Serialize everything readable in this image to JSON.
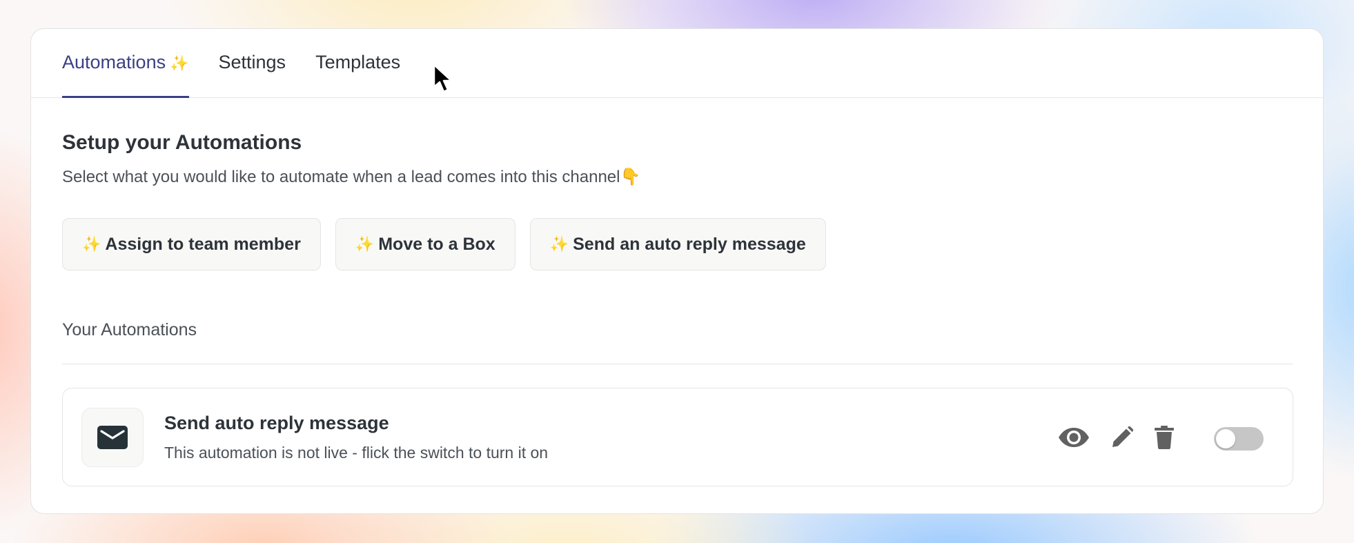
{
  "tabs": [
    {
      "label": "Automations",
      "spark": "✨",
      "active": true
    },
    {
      "label": "Settings",
      "active": false
    },
    {
      "label": "Templates",
      "active": false
    }
  ],
  "header": {
    "title": "Setup your Automations",
    "subtitle": "Select what you would like to automate when a lead comes into this channel👇"
  },
  "actions": [
    {
      "spark": "✨",
      "label": "Assign to team member"
    },
    {
      "spark": "✨",
      "label": "Move to a Box"
    },
    {
      "spark": "✨",
      "label": "Send an auto reply message"
    }
  ],
  "automations_section": {
    "label": "Your Automations",
    "items": [
      {
        "icon": "envelope-icon",
        "name": "Send auto reply message",
        "description": "This automation is not live - flick the switch to turn it on",
        "enabled": false
      }
    ]
  },
  "colors": {
    "accent": "#3b3f86",
    "text": "#2d3339",
    "muted": "#4a5057",
    "toggle_off": "#c6c6c6"
  }
}
